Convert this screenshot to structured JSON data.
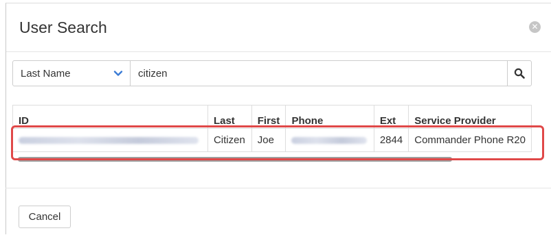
{
  "dialog": {
    "title": "User Search",
    "close_icon": "close-circle-icon"
  },
  "search": {
    "field_selected": "Last Name",
    "dropdown_icon": "chevron-down-icon",
    "query": "citizen",
    "search_icon": "magnifier-icon",
    "accent_color": "#3a7bd5"
  },
  "results": {
    "columns": [
      "ID",
      "Last",
      "First",
      "Phone",
      "Ext",
      "Service Provider"
    ],
    "rows": [
      {
        "id": "",
        "last": "Citizen",
        "first": "Joe",
        "phone": "",
        "ext": "2844",
        "service_provider": "Commander Phone R20"
      }
    ],
    "highlight_color": "#e04848"
  },
  "footer": {
    "cancel_label": "Cancel"
  }
}
